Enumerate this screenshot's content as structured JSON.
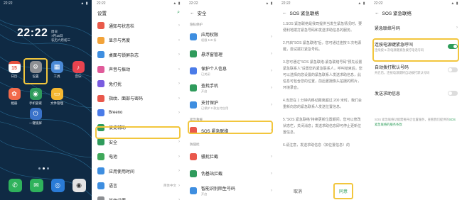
{
  "panel1": {
    "status_time": "22:22",
    "clock": "22:22",
    "date_line1": "周日",
    "date_line2": "7月15日",
    "date_line3": "农历六月初三",
    "apps": [
      {
        "label": "日历",
        "icon": "calendar-icon",
        "color": "#e8513f",
        "glyph": "15"
      },
      {
        "label": "设置",
        "icon": "settings-gear-icon",
        "color": "#8d8f93",
        "glyph": "⚙"
      },
      {
        "label": "工具",
        "icon": "tools-folder-icon",
        "color": "#4a89d6",
        "glyph": "▦"
      },
      {
        "label": "音乐",
        "icon": "music-icon",
        "color": "#e8434f",
        "glyph": "♪"
      },
      {
        "label": "相册",
        "icon": "gallery-icon",
        "color": "#f26a4b",
        "glyph": "✿"
      },
      {
        "label": "手机管家",
        "icon": "phone-manager-icon",
        "color": "#2f9b5c",
        "glyph": "◉"
      },
      {
        "label": "文件管理",
        "icon": "file-manager-icon",
        "color": "#f5b731",
        "glyph": "▭"
      },
      {
        "label": "一键锁屏",
        "icon": "lock-screen-icon",
        "color": "#3a72c9",
        "glyph": "⏻"
      }
    ],
    "dock": [
      {
        "icon": "phone-icon",
        "color": "#2fb25c",
        "glyph": "✆"
      },
      {
        "icon": "messages-icon",
        "color": "#2fb25c",
        "glyph": "✉"
      },
      {
        "icon": "browser-icon",
        "color": "#2a7bd6",
        "glyph": "◎"
      },
      {
        "icon": "camera-icon",
        "color": "#e4e4e4",
        "glyph": "◉"
      }
    ]
  },
  "panel2": {
    "status_time": "22:22",
    "title": "设置",
    "items": [
      {
        "label": "通知与状态栏",
        "color": "#e95a4a",
        "icon": "notification-icon"
      },
      {
        "label": "显示与亮度",
        "color": "#f2a33a",
        "icon": "display-icon"
      },
      {
        "label": "桌面与锁屏杂志",
        "color": "#3e8ee0",
        "icon": "wallpaper-icon"
      },
      {
        "label": "声音与振动",
        "color": "#e05b9a",
        "icon": "sound-icon"
      },
      {
        "label": "免打扰",
        "color": "#7a5ce0",
        "icon": "do-not-disturb-icon"
      },
      {
        "label": "指纹、面部与密码",
        "color": "#e9584c",
        "icon": "fingerprint-icon"
      },
      {
        "label": "Breeno",
        "color": "#4a7be8",
        "icon": "breeno-icon"
      },
      {
        "label": "便捷辅助",
        "color": "#2f9b5c",
        "icon": "accessibility-icon"
      },
      {
        "label": "安全",
        "color": "#2f9b5c",
        "icon": "security-icon"
      },
      {
        "label": "电池",
        "color": "#3fa85a",
        "icon": "battery-icon"
      },
      {
        "label": "应用使用时间",
        "color": "#3e8ee0",
        "icon": "screen-time-icon"
      },
      {
        "label": "语言",
        "color": "#3e8ee0",
        "icon": "language-icon"
      },
      {
        "label": "其他设置",
        "color": "#8d8f93",
        "icon": "more-settings-icon"
      }
    ],
    "language_value": "简体中文"
  },
  "panel3": {
    "status_time": "22:22",
    "title": "安全",
    "sec_privacy": "隐私保护",
    "items_a": [
      {
        "label": "应用权限",
        "sub": "权限 119 条",
        "color": "#3e8ee0",
        "icon": "app-permissions-icon"
      },
      {
        "label": "悬浮窗管理",
        "sub": "",
        "color": "#2f9b5c",
        "icon": "floating-window-icon"
      },
      {
        "label": "保护个人信息",
        "sub": "已关闭",
        "color": "#4a7be8",
        "icon": "privacy-icon"
      },
      {
        "label": "查找手机",
        "sub": "开启",
        "color": "#2f9b5c",
        "icon": "find-phone-icon"
      },
      {
        "label": "支付保护",
        "sub": "已保护 2 款支付应用",
        "color": "#3e8ee0",
        "icon": "payment-protection-icon"
      }
    ],
    "sec_emergency": "紧急救援",
    "sos": {
      "label": "SOS 紧急联络",
      "color": "#e9584c",
      "icon": "sos-icon"
    },
    "sec_anti": "防骚扰",
    "items_b": [
      {
        "label": "骚扰拦截",
        "sub": "",
        "color": "#e9584c",
        "icon": "block-icon"
      },
      {
        "label": "伪基站拦截",
        "sub": "",
        "color": "#2f9b5c",
        "icon": "fake-station-icon"
      },
      {
        "label": "智能识别陌生号码",
        "sub": "开启",
        "color": "#3e8ee0",
        "icon": "caller-id-icon"
      }
    ]
  },
  "panel4": {
    "status_time": "22:22",
    "title": "SOS 紧急联络",
    "paragraphs": [
      "1.SOS 紧急联络是我司提供当发生紧急情况时，要便利地拨打紧急号码和发送求助信息的服务。",
      "2.开启\"SOS 紧急联络\"后，您可通过连按 5 次电源键，尝试拨打紧急号码。",
      "3.您可通过\"SOS 紧急联络-紧急联络号码\"预先设置紧急联系人\"设置您的紧急联系人，呼叫结束后，您可以选择向您设置的紧急联系人发送求助信息，此信息可包含您的位置，前后置摄像头拍摄的照片，环境录音。",
      "4.当您在 1 分钟内移动距离超过 200 米时，我们会重新向您的紧急联系人发送位置信息。",
      "5.\"SOS 紧急联络\"持续更新位置期间，您可以修改状态栏，关闭消息；发送求助信息即可停止更新位置信息。",
      "6.请注意，发送求助信息（如位置信息）的"
    ],
    "cancel": "取消",
    "agree": "同意"
  },
  "panel5": {
    "status_time": "22:22",
    "title": "SOS 紧急联络",
    "contacts": {
      "label": "紧急联络号码",
      "sub": ""
    },
    "power_press": {
      "label": "连按电源键紧急呼叫",
      "sub": "连续按 5 次电源键紧急拨打电话号码"
    },
    "auto_dial": {
      "label": "自动拨打默认号码",
      "sub": "开启后，连按电源键将自动拨打默认号码"
    },
    "send_help": {
      "label": "发送求助信息",
      "sub": ""
    },
    "footer_text": "SOS 紧急联络功能需要开启位置服务，查看我们提供的",
    "footer_link": "SOS 紧急联络的服务条款"
  }
}
